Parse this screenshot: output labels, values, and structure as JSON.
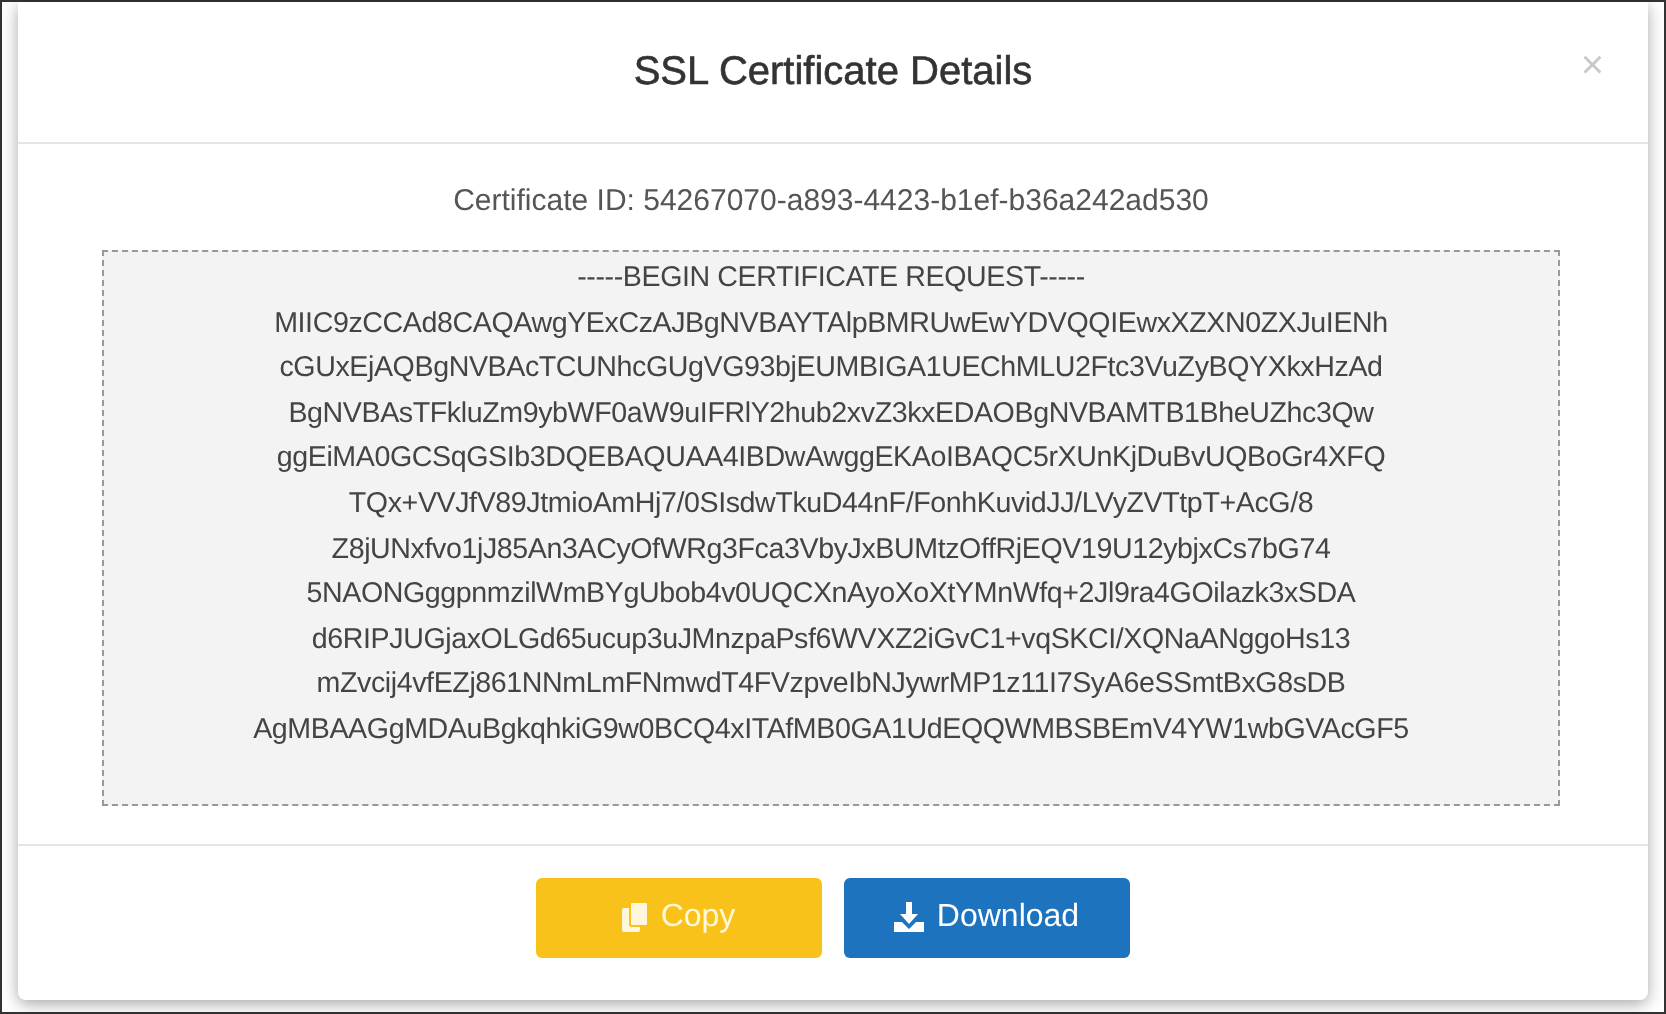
{
  "modal": {
    "title": "SSL Certificate Details",
    "close": "×"
  },
  "certificate_id": "Certificate ID: 54267070-a893-4423-b1ef-b36a242ad530",
  "certificate_lines": [
    "-----BEGIN CERTIFICATE REQUEST-----",
    "MIIC9zCCAd8CAQAwgYExCzAJBgNVBAYTAlpBMRUwEwYDVQQIEwxXZXN0ZXJuIENh",
    "cGUxEjAQBgNVBAcTCUNhcGUgVG93bjEUMBIGA1UEChMLU2Ftc3VuZyBQYXkxHzAd",
    "BgNVBAsTFkluZm9ybWF0aW9uIFRlY2hub2xvZ3kxEDAOBgNVBAMTB1BheUZhc3Qw",
    "ggEiMA0GCSqGSIb3DQEBAQUAA4IBDwAwggEKAoIBAQC5rXUnKjDuBvUQBoGr4XFQ",
    "TQx+VVJfV89JtmioAmHj7/0SIsdwTkuD44nF/FonhKuvidJJ/LVyZVTtpT+AcG/8",
    "Z8jUNxfvo1jJ85An3ACyOfWRg3Fca3VbyJxBUMtzOffRjEQV19U12ybjxCs7bG74",
    "5NAONGggpnmzilWmBYgUbob4v0UQCXnAyoXoXtYMnWfq+2Jl9ra4GOilazk3xSDA",
    "d6RIPJUGjaxOLGd65ucup3uJMnzpaPsf6WVXZ2iGvC1+vqSKCI/XQNaANggoHs13",
    "mZvcij4vfEZj861NNmLmFNmwdT4FVzpveIbNJywrMP1z11I7SyA6eSSmtBxG8sDB",
    "AgMBAAGgMDAuBgkqhkiG9w0BCQ4xITAfMB0GA1UdEQQWMBSBEmV4YW1wbGVAcGF5"
  ],
  "buttons": [
    {
      "label": "Copy",
      "kind": "copy"
    },
    {
      "label": "Download",
      "kind": "download"
    }
  ]
}
